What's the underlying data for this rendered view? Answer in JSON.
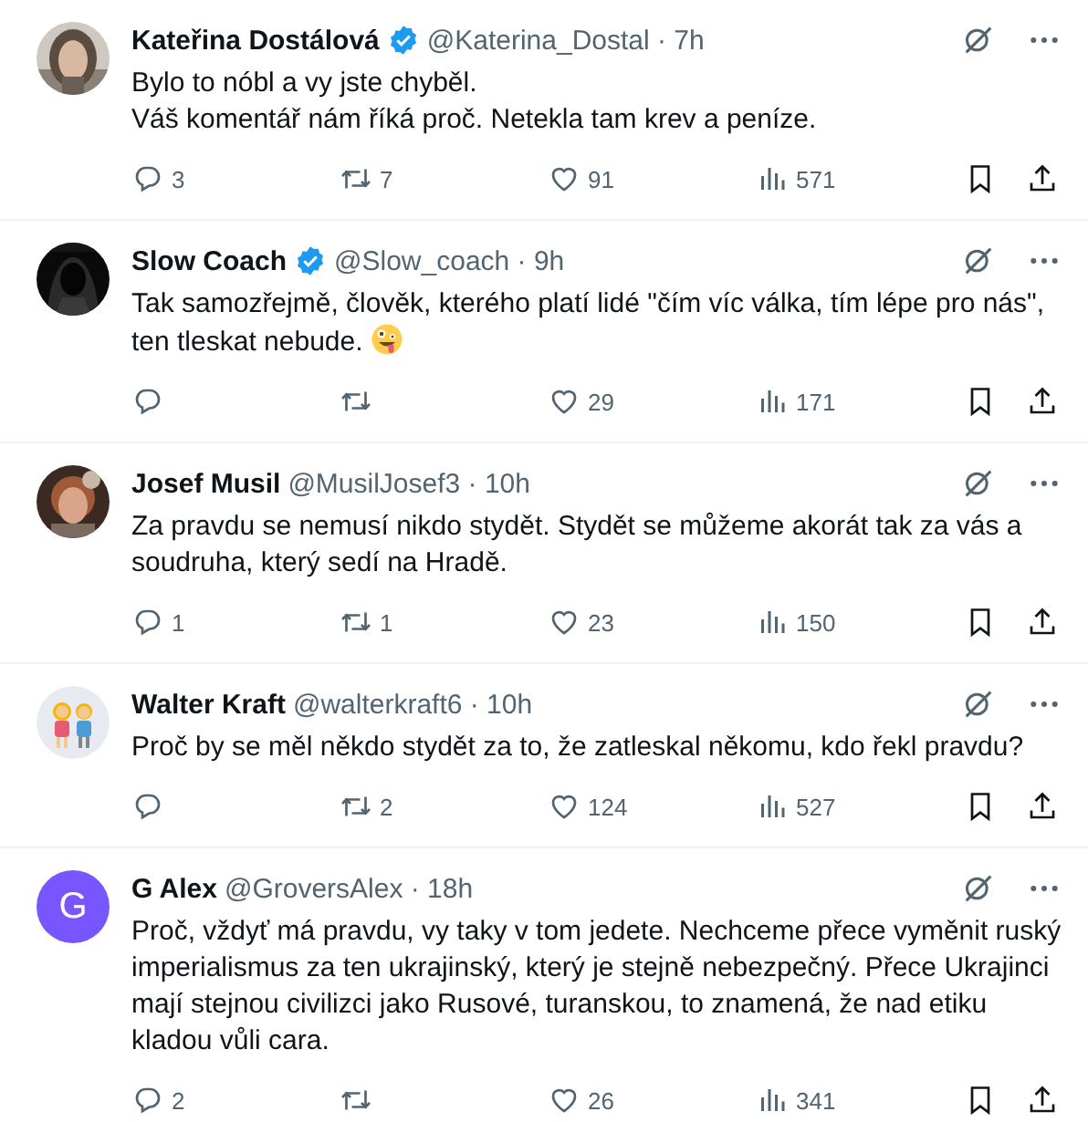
{
  "tweets": [
    {
      "name": "Kateřina Dostálová",
      "verified": true,
      "meta": "@Katerina_Dostal · 7h",
      "text": "Bylo to nóbl a vy jste chyběl.\nVáš komentář nám říká proč. Netekla tam krev a peníze.",
      "emoji": false,
      "replies": "3",
      "reposts": "7",
      "likes": "91",
      "views": "571"
    },
    {
      "name": "Slow Coach",
      "verified": true,
      "meta": "@Slow_coach · 9h",
      "text": "Tak samozřejmě, člověk, kterého platí lidé \"čím víc válka, tím lépe pro nás\", ten tleskat nebude.",
      "emoji": true,
      "likes": "29",
      "views": "171"
    },
    {
      "name": "Josef Musil",
      "verified": false,
      "meta": "@MusilJosef3 · 10h",
      "text": "Za pravdu se nemusí nikdo stydět. Stydět se můžeme akorát tak za vás a soudruha, který sedí na Hradě.",
      "emoji": false,
      "replies": "1",
      "reposts": "1",
      "likes": "23",
      "views": "150"
    },
    {
      "name": "Walter Kraft",
      "verified": false,
      "meta": "@walterkraft6 · 10h",
      "avatar": {
        "kind": "couple"
      },
      "text": "Proč by se měl někdo stydět za to, že zatleskal někomu, kdo řekl pravdu?",
      "emoji": false,
      "reposts": "2",
      "likes": "124",
      "views": "527"
    },
    {
      "name": "G Alex",
      "verified": false,
      "meta": "@GroversAlex · 18h",
      "avatar": {
        "kind": "letter",
        "letter": "G"
      },
      "text": "Proč, vždyť má pravdu, vy taky v tom jedete. Nechceme přece vyměnit ruský imperialismus za ten ukrajinský, který je stejně nebezpečný. Přece Ukrajinci mají stejnou civilizci jako Rusové, turanskou, to znamená, že nad etiku kladou vůli cara.",
      "emoji": false,
      "replies": "2",
      "likes": "26",
      "views": "341"
    }
  ]
}
